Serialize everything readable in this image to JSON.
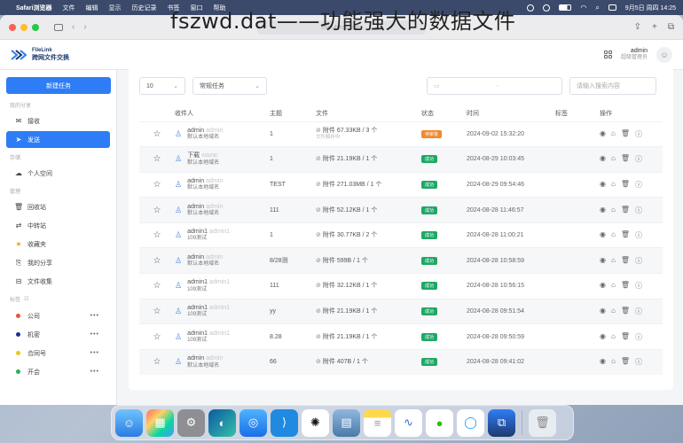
{
  "menubar": {
    "app": "Safari浏览器",
    "items": [
      "文件",
      "编辑",
      "显示",
      "历史记录",
      "书签",
      "窗口",
      "帮助"
    ],
    "datetime": "9月5日 周四  14:25"
  },
  "overlay_title": "fszwd.dat——功能强大的数据文件",
  "browser": {
    "url_text": "ma.ubesc.com"
  },
  "app": {
    "logo_line1": "FileLink",
    "logo_line2": "跨网文件交换",
    "user_name": "admin",
    "user_role": "超级管理员"
  },
  "sidebar": {
    "new_task": "新建任务",
    "sections": {
      "send": "我的分享",
      "storage": "存储",
      "manage": "管理",
      "tags": "标签"
    },
    "items": [
      {
        "label": "接收",
        "icon": "mail-icon"
      },
      {
        "label": "发送",
        "icon": "send-icon"
      },
      {
        "label": "个人空间",
        "icon": "cloud-icon"
      },
      {
        "label": "回收站",
        "icon": "trash-icon"
      },
      {
        "label": "中转站",
        "icon": "transfer-icon"
      },
      {
        "label": "收藏夹",
        "icon": "star-icon"
      },
      {
        "label": "我的分享",
        "icon": "share-icon"
      },
      {
        "label": "文件收集",
        "icon": "collect-icon"
      }
    ],
    "tags": [
      {
        "label": "公司",
        "color": "#e8533c"
      },
      {
        "label": "机密",
        "color": "#1f2f8f"
      },
      {
        "label": "合同号",
        "color": "#f0c419"
      },
      {
        "label": "开会",
        "color": "#27b04f"
      }
    ]
  },
  "filters": {
    "page_size": "10",
    "task_type": "常规任务",
    "date_sep": "-",
    "search_placeholder": "请输入搜索内容"
  },
  "table": {
    "headers": [
      "收件人",
      "主题",
      "文件",
      "状态",
      "时间",
      "标签",
      "操作"
    ],
    "rows": [
      {
        "name": "admin",
        "name2": "admin",
        "group": "默认本地域名",
        "subject": "1",
        "file": "附件 67.33KB / 3 个",
        "file_sub": "文件解析中",
        "status": "待审批",
        "time": "2024-09-02 15:32:20"
      },
      {
        "name": "下载",
        "name2": "xiazai",
        "group": "默认本地域名",
        "subject": "1",
        "file": "附件 21.19KB / 1 个",
        "file_sub": "",
        "status": "成功",
        "time": "2024-08-29 10:03:45"
      },
      {
        "name": "admin",
        "name2": "admin",
        "group": "默认本地域名",
        "subject": "TEST",
        "file": "附件 271.03MB / 1 个",
        "file_sub": "",
        "status": "成功",
        "time": "2024-08-29 09:54:46"
      },
      {
        "name": "admin",
        "name2": "admin",
        "group": "默认本地域名",
        "subject": "111",
        "file": "附件 52.12KB / 1 个",
        "file_sub": "",
        "status": "成功",
        "time": "2024-08-28 11:46:57"
      },
      {
        "name": "admin1",
        "name2": "admin1",
        "group": "109测试",
        "subject": "1",
        "file": "附件 30.77KB / 2 个",
        "file_sub": "",
        "status": "成功",
        "time": "2024-08-28 11:00:21"
      },
      {
        "name": "admin",
        "name2": "admin",
        "group": "默认本地域名",
        "subject": "8/28测",
        "file": "附件 599B / 1 个",
        "file_sub": "",
        "status": "成功",
        "time": "2024-08-28 10:58:59"
      },
      {
        "name": "admin1",
        "name2": "admin1",
        "group": "109测试",
        "subject": "111",
        "file": "附件 32.12KB / 1 个",
        "file_sub": "",
        "status": "成功",
        "time": "2024-08-28 10:56:15"
      },
      {
        "name": "admin1",
        "name2": "admin1",
        "group": "109测试",
        "subject": "yy",
        "file": "附件 21.19KB / 1 个",
        "file_sub": "",
        "status": "成功",
        "time": "2024-08-28 09:51:54"
      },
      {
        "name": "admin1",
        "name2": "admin1",
        "group": "109测试",
        "subject": "8.28",
        "file": "附件 21.19KB / 1 个",
        "file_sub": "",
        "status": "成功",
        "time": "2024-08-28 09:50:59"
      },
      {
        "name": "admin",
        "name2": "admin",
        "group": "默认本地域名",
        "subject": "66",
        "file": "附件 407B / 1 个",
        "file_sub": "",
        "status": "成功",
        "time": "2024-08-28 09:41:02"
      }
    ]
  },
  "colors": {
    "accent": "#2f7df6",
    "success": "#1fa866",
    "pending": "#f08a2c"
  },
  "dock": [
    "finder-icon",
    "launchpad-icon",
    "settings-icon",
    "edge-icon",
    "safari-icon",
    "vscode-icon",
    "chatgpt-icon",
    "preview-icon",
    "notes-icon",
    "freeform-icon",
    "wechat-icon",
    "qq-icon",
    "filelink-icon",
    "trash-icon"
  ]
}
